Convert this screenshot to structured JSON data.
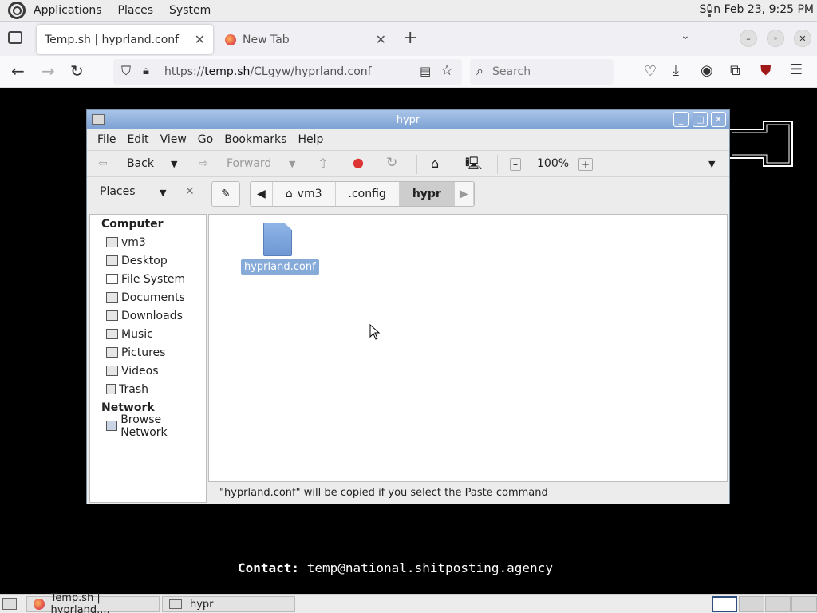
{
  "panel": {
    "menus": [
      "Applications",
      "Places",
      "System"
    ],
    "clock": "Sun Feb 23,  9:25 PM"
  },
  "browser": {
    "tabs": [
      {
        "title": "Temp.sh | hyprland.conf",
        "active": true
      },
      {
        "title": "New Tab",
        "active": false
      }
    ],
    "url_prefix": "https://",
    "url_host": "temp.sh",
    "url_path": "/CLgyw/hyprland.conf",
    "search_placeholder": "Search"
  },
  "page": {
    "contact_label": "Contact:",
    "contact_value": "temp@national.shitposting.agency"
  },
  "file_manager": {
    "title": "hypr",
    "menu": [
      "File",
      "Edit",
      "View",
      "Go",
      "Bookmarks",
      "Help"
    ],
    "toolbar": {
      "back": "Back",
      "forward": "Forward",
      "zoom": "100%"
    },
    "sidebar_header": "Places",
    "breadcrumbs": [
      "vm3",
      ".config",
      "hypr"
    ],
    "sidebar": {
      "computer_label": "Computer",
      "computer_items": [
        "vm3",
        "Desktop",
        "File System",
        "Documents",
        "Downloads",
        "Music",
        "Pictures",
        "Videos",
        "Trash"
      ],
      "network_label": "Network",
      "network_items": [
        "Browse Network"
      ]
    },
    "files": [
      {
        "name": "hyprland.conf",
        "selected": true
      }
    ],
    "status": "\"hyprland.conf\" will be copied if you select the Paste command"
  },
  "taskbar": {
    "tasks": [
      "Temp.sh | hyprland....",
      "hypr"
    ]
  },
  "colors": {
    "title_bar": "#7ca1d3",
    "selection": "#86abd9",
    "page_bg": "#000000"
  }
}
